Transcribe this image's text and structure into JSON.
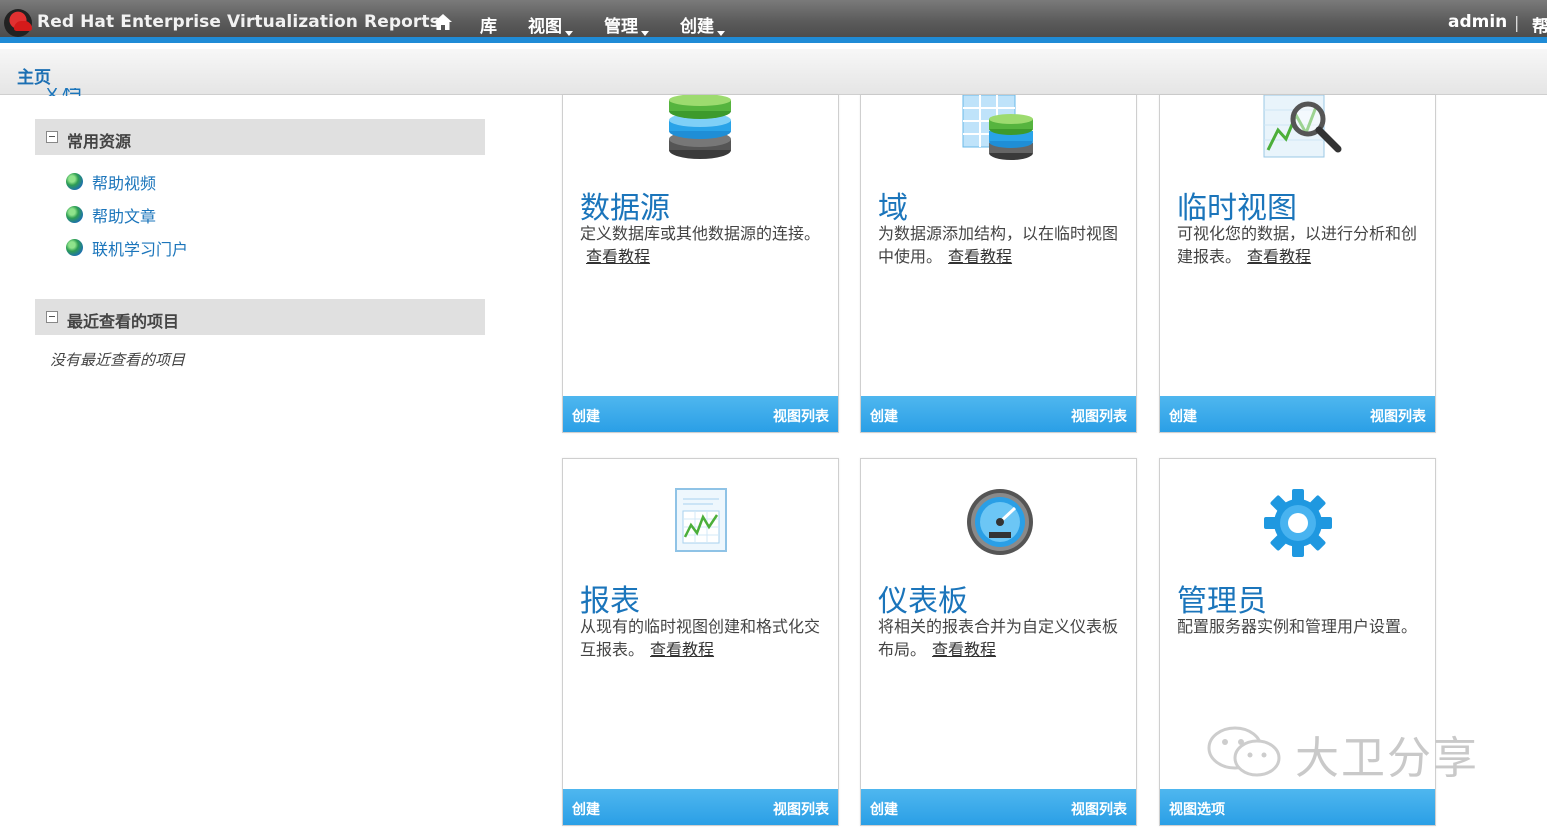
{
  "header": {
    "app_title": "Red Hat Enterprise Virtualization Reports",
    "nav": [
      {
        "label": "库",
        "dropdown": false
      },
      {
        "label": "视图",
        "dropdown": true
      },
      {
        "label": "管理",
        "dropdown": true
      },
      {
        "label": "创建",
        "dropdown": true
      }
    ],
    "user": "admin",
    "separator": "|",
    "help_partial": "帮"
  },
  "breadcrumb": {
    "current": "主页"
  },
  "sidebar": {
    "cut_heading": "文档",
    "common_resources": {
      "title": "常用资源",
      "items": [
        "帮助视频",
        "帮助文章",
        "联机学习门户"
      ]
    },
    "recent": {
      "title": "最近查看的项目",
      "empty_text": "没有最近查看的项目"
    }
  },
  "cards": [
    {
      "title": "数据源",
      "desc": "定义数据库或其他数据源的连接。",
      "link": "查看教程",
      "left_action": "创建",
      "right_action": "视图列表",
      "icon": "database-icon"
    },
    {
      "title": "域",
      "desc": "为数据源添加结构，以在临时视图中使用。",
      "link": "查看教程",
      "left_action": "创建",
      "right_action": "视图列表",
      "icon": "domain-icon"
    },
    {
      "title": "临时视图",
      "desc": "可视化您的数据，以进行分析和创建报表。",
      "link": "查看教程",
      "left_action": "创建",
      "right_action": "视图列表",
      "icon": "adhoc-view-icon"
    },
    {
      "title": "报表",
      "desc": "从现有的临时视图创建和格式化交互报表。",
      "link": "查看教程",
      "left_action": "创建",
      "right_action": "视图列表",
      "icon": "report-icon"
    },
    {
      "title": "仪表板",
      "desc": "将相关的报表合并为自定义仪表板布局。",
      "link": "查看教程",
      "left_action": "创建",
      "right_action": "视图列表",
      "icon": "dashboard-icon"
    },
    {
      "title": "管理员",
      "desc": "配置服务器实例和管理用户设置。",
      "link": "",
      "left_action": "视图选项",
      "right_action": "",
      "icon": "gear-icon"
    }
  ],
  "watermark": {
    "text": "大卫分享"
  }
}
